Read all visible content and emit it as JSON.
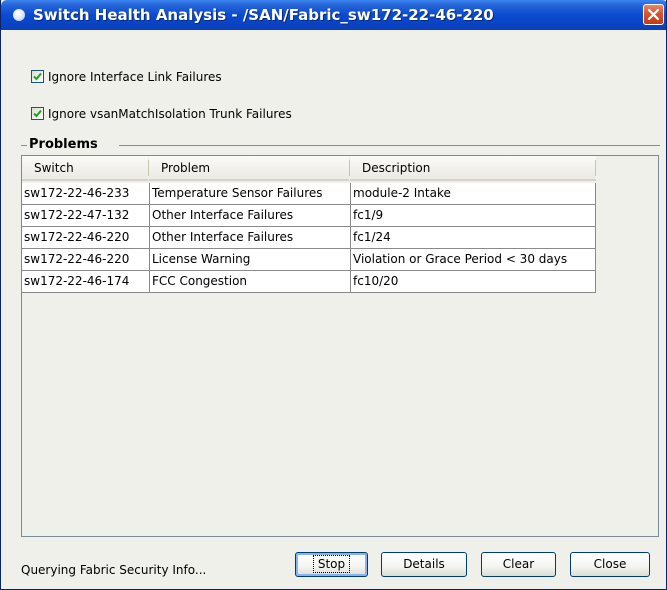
{
  "window": {
    "title": "Switch Health Analysis - /SAN/Fabric_sw172-22-46-220"
  },
  "options": [
    {
      "label": "Ignore Interface Link Failures",
      "checked": true
    },
    {
      "label": "Ignore vsanMatchIsolation Trunk Failures",
      "checked": true
    }
  ],
  "problems": {
    "group_title": "Problems",
    "columns": [
      "Switch",
      "Problem",
      "Description"
    ],
    "rows": [
      {
        "switch": "sw172-22-46-233",
        "problem": "Temperature Sensor Failures",
        "description": "module-2 Intake"
      },
      {
        "switch": "sw172-22-47-132",
        "problem": "Other Interface Failures",
        "description": "fc1/9"
      },
      {
        "switch": "sw172-22-46-220",
        "problem": "Other Interface Failures",
        "description": "fc1/24"
      },
      {
        "switch": "sw172-22-46-220",
        "problem": "License Warning",
        "description": "Violation or Grace Period < 30 days"
      },
      {
        "switch": "sw172-22-46-174",
        "problem": "FCC Congestion",
        "description": "fc10/20"
      }
    ]
  },
  "buttons": {
    "stop": "Stop",
    "details": "Details",
    "clear": "Clear",
    "close": "Close"
  },
  "status": {
    "text": "Querying Fabric Security Info..."
  },
  "icons": {
    "title": "app-icon",
    "close": "close-icon",
    "check": "checkmark-icon"
  },
  "colors": {
    "titlebar": "#0a43c4",
    "close_button": "#d8532c",
    "window_bg": "#f0f0ea"
  }
}
